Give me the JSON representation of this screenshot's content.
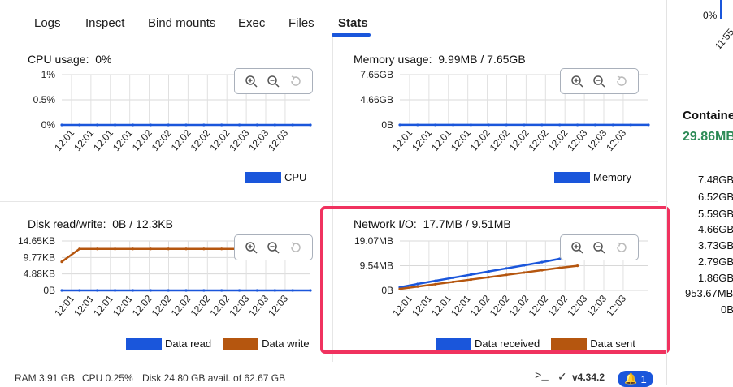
{
  "tabs": [
    {
      "label": "Logs"
    },
    {
      "label": "Inspect"
    },
    {
      "label": "Bind mounts"
    },
    {
      "label": "Exec"
    },
    {
      "label": "Files"
    },
    {
      "label": "Stats"
    }
  ],
  "active_tab": "Stats",
  "zoom_icons": [
    "zoom-in-icon",
    "zoom-out-icon",
    "reset-zoom-icon"
  ],
  "panels": {
    "cpu": {
      "title": "CPU usage:",
      "value": "0%",
      "legend": [
        "CPU"
      ]
    },
    "memory": {
      "title": "Memory usage:",
      "value": "9.99MB / 7.65GB",
      "legend": [
        "Memory"
      ]
    },
    "disk": {
      "title": "Disk read/write:",
      "value": "0B / 12.3KB",
      "legend": [
        "Data read",
        "Data write"
      ]
    },
    "network": {
      "title": "Network I/O:",
      "value": "17.7MB / 9.51MB",
      "legend": [
        "Data received",
        "Data sent"
      ]
    }
  },
  "chart_data": [
    {
      "type": "line",
      "title": "CPU usage",
      "x": [
        "12:01",
        "12:01",
        "12:01",
        "12:01",
        "12:02",
        "12:02",
        "12:02",
        "12:02",
        "12:02",
        "12:03",
        "12:03",
        "12:03"
      ],
      "y_ticks": [
        "1%",
        "0.5%",
        "0%"
      ],
      "ylim": [
        0,
        1
      ],
      "series": [
        {
          "name": "CPU",
          "color": "#1a56db",
          "values": [
            0,
            0,
            0,
            0,
            0,
            0,
            0,
            0,
            0,
            0,
            0,
            0,
            0,
            0,
            0
          ]
        }
      ]
    },
    {
      "type": "line",
      "title": "Memory usage",
      "x": [
        "12:01",
        "12:01",
        "12:01",
        "12:01",
        "12:02",
        "12:02",
        "12:02",
        "12:02",
        "12:02",
        "12:03",
        "12:03",
        "12:03"
      ],
      "y_ticks": [
        "7.65GB",
        "4.66GB",
        "0B"
      ],
      "ylim": [
        0,
        7.65
      ],
      "series": [
        {
          "name": "Memory",
          "color": "#1a56db",
          "values": [
            0.01,
            0.01,
            0.01,
            0.01,
            0.01,
            0.01,
            0.01,
            0.01,
            0.01,
            0.01,
            0.01,
            0.01,
            0.01,
            0.01,
            0.01
          ]
        }
      ]
    },
    {
      "type": "line",
      "title": "Disk read/write",
      "x": [
        "12:01",
        "12:01",
        "12:01",
        "12:01",
        "12:02",
        "12:02",
        "12:02",
        "12:02",
        "12:02",
        "12:03",
        "12:03",
        "12:03"
      ],
      "y_ticks": [
        "14.65KB",
        "9.77KB",
        "4.88KB",
        "0B"
      ],
      "ylim": [
        0,
        14.65
      ],
      "series": [
        {
          "name": "Data read",
          "color": "#1a56db",
          "values": [
            0,
            0,
            0,
            0,
            0,
            0,
            0,
            0,
            0,
            0,
            0,
            0,
            0,
            0,
            0
          ]
        },
        {
          "name": "Data write",
          "color": "#b5560f",
          "values": [
            8.5,
            12.3,
            12.3,
            12.3,
            12.3,
            12.3,
            12.3,
            12.3,
            12.3,
            12.3,
            12.3
          ]
        }
      ]
    },
    {
      "type": "line",
      "title": "Network I/O",
      "x": [
        "12:01",
        "12:01",
        "12:01",
        "12:01",
        "12:02",
        "12:02",
        "12:02",
        "12:02",
        "12:02",
        "12:03",
        "12:03",
        "12:03"
      ],
      "y_ticks": [
        "19.07MB",
        "9.54MB",
        "0B"
      ],
      "ylim": [
        0,
        19.07
      ],
      "series": [
        {
          "name": "Data received",
          "color": "#1a56db",
          "values": [
            1.2,
            2.5,
            3.7,
            4.9,
            6.1,
            7.3,
            8.5,
            9.7,
            10.9,
            12.2
          ]
        },
        {
          "name": "Data sent",
          "color": "#b5560f",
          "values": [
            0.6,
            1.5,
            2.4,
            3.3,
            4.2,
            5.1,
            6.0,
            6.9,
            7.8,
            8.7,
            9.5
          ]
        }
      ]
    }
  ],
  "right_panel": {
    "top_value": "0%",
    "top_ticks": [
      "11:55"
    ],
    "heading": "Containe",
    "value": "29.86MB",
    "value_color": "#2e8b57",
    "ticks": [
      "7.48GB",
      "6.52GB",
      "5.59GB",
      "4.66GB",
      "3.73GB",
      "2.79GB",
      "1.86GB",
      "953.67MB",
      "0B"
    ]
  },
  "status_bar": {
    "ram": "RAM 3.91 GB",
    "cpu": "CPU 0.25%",
    "disk": "Disk 24.80 GB avail. of 62.67 GB",
    "terminal_icon": ">_",
    "version": "v4.34.2",
    "notifications": "1"
  }
}
